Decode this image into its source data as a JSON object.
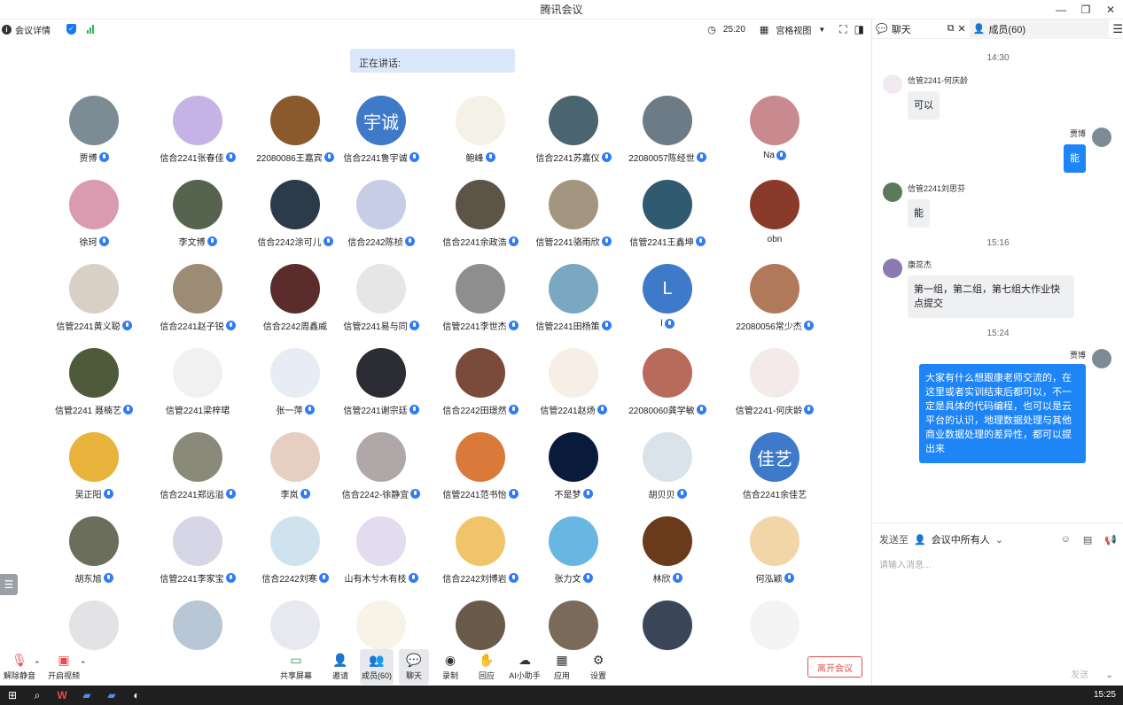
{
  "app": {
    "title": "腾讯会议"
  },
  "infobar": {
    "meeting_info": "会议详情",
    "timer": "25:20",
    "view": "宫格视图"
  },
  "speaking": {
    "label": "正在讲话:"
  },
  "participants": [
    {
      "name": "贾博",
      "color": "#7b8c95"
    },
    {
      "name": "信合2241张春佳",
      "color": "#c5b3e6"
    },
    {
      "name": "22080086王嘉宾",
      "color": "#8a5a2c"
    },
    {
      "name": "信合2241鲁宇诚",
      "color": "#3f79c9",
      "initials": "宇诚"
    },
    {
      "name": "鲍峰",
      "color": "#f4f1e6"
    },
    {
      "name": "信合2241苏嘉仪",
      "color": "#4a6470"
    },
    {
      "name": "22080057陈经世",
      "color": "#6c7b86"
    },
    {
      "name": "Na",
      "color": "#c88a8f"
    },
    {
      "name": "徐珂",
      "color": "#d99bb0"
    },
    {
      "name": "李文博",
      "color": "#56634e"
    },
    {
      "name": "信合2242涂可儿",
      "color": "#2b3b4a"
    },
    {
      "name": "信合2242陈桢",
      "color": "#c7cde6"
    },
    {
      "name": "信合2241余政浩",
      "color": "#5e5347"
    },
    {
      "name": "信管2241骆雨欣",
      "color": "#a39680"
    },
    {
      "name": "信管2241王鑫坤",
      "color": "#2f5a70"
    },
    {
      "name": "obn",
      "color": "#8a3a2a"
    },
    {
      "name": "信管2241黄义聪",
      "color": "#d9cfc5"
    },
    {
      "name": "信合2241赵子锐",
      "color": "#9c8c76"
    },
    {
      "name": "信合2242周鑫威",
      "color": "#5a2c2c"
    },
    {
      "name": "信管2241易与同",
      "color": "#e6e6e6"
    },
    {
      "name": "信管2241李世杰",
      "color": "#8e8e8e"
    },
    {
      "name": "信管2241田杨策",
      "color": "#7aa8c2"
    },
    {
      "name": "l",
      "color": "#3f79c9",
      "initials": "L"
    },
    {
      "name": "22080056常少杰",
      "color": "#b07a5a"
    },
    {
      "name": "信管2241 聂楠艺",
      "color": "#4e5a3a"
    },
    {
      "name": "信管2241梁梓珺",
      "color": "#f1f1f1"
    },
    {
      "name": "张一萍",
      "color": "#e8edf5"
    },
    {
      "name": "信管2241谢宗廷",
      "color": "#2c2c34"
    },
    {
      "name": "信合2242田璟然",
      "color": "#7a4a3a"
    },
    {
      "name": "信管2241赵炀",
      "color": "#f7efe6"
    },
    {
      "name": "22080060龚学敏",
      "color": "#b86b5a"
    },
    {
      "name": "信管2241-何庆龄",
      "color": "#f5eaea"
    },
    {
      "name": "吴正阳",
      "color": "#e8b33a"
    },
    {
      "name": "信合2241郑远溢",
      "color": "#8a8a7a"
    },
    {
      "name": "李岚",
      "color": "#e6cfc0"
    },
    {
      "name": "信合2242-徐静宜",
      "color": "#b0a8a8"
    },
    {
      "name": "信管2241范书怡",
      "color": "#d97a3a"
    },
    {
      "name": "不是梦",
      "color": "#0a1a3a"
    },
    {
      "name": "胡贝贝",
      "color": "#dbe3ea"
    },
    {
      "name": "信合2241余佳艺",
      "color": "#3f79c9",
      "initials": "佳艺"
    },
    {
      "name": "胡东旭",
      "color": "#6a6e5a"
    },
    {
      "name": "信管2241李家宝",
      "color": "#d6d6e6"
    },
    {
      "name": "信合2242刘寒",
      "color": "#cfe3ee"
    },
    {
      "name": "山有木兮木有枝",
      "color": "#e3dbee"
    },
    {
      "name": "信合2242刘博岩",
      "color": "#f2c46a"
    },
    {
      "name": "张力文",
      "color": "#6ab6e3"
    },
    {
      "name": "林欣",
      "color": "#6a3a1a"
    },
    {
      "name": "何泓颖",
      "color": "#f1d6a8"
    },
    {
      "name": "",
      "color": "#e3e3e6"
    },
    {
      "name": "",
      "color": "#b8c6d6"
    },
    {
      "name": "",
      "color": "#e8e8f0"
    },
    {
      "name": "",
      "color": "#f7f3e6"
    },
    {
      "name": "",
      "color": "#6a5a4a"
    },
    {
      "name": "",
      "color": "#7a6a5a"
    },
    {
      "name": "",
      "color": "#3a4658"
    },
    {
      "name": "",
      "color": "#f4f4f4"
    }
  ],
  "toolbar": {
    "unmute": "解除静音",
    "start_video": "开启视频",
    "share": "共享屏幕",
    "invite": "邀请",
    "members": "成员(60)",
    "chat": "聊天",
    "record": "录制",
    "react": "回应",
    "ai": "AI小助手",
    "apps": "应用",
    "settings": "设置",
    "leave": "离开会议"
  },
  "chat": {
    "tab_chat": "聊天",
    "tab_members": "成员(60)",
    "messages": [
      {
        "time": "14:30"
      },
      {
        "sender": "信管2241-何庆龄",
        "text": "可以",
        "dir": "in"
      },
      {
        "sender": "贾博",
        "text": "能",
        "dir": "out"
      },
      {
        "sender": "信管2241刘思芬",
        "text": "能",
        "dir": "in"
      },
      {
        "time": "15:16"
      },
      {
        "sender": "康蕊杰",
        "text": "第一组，第二组，第七组大作业快点提交",
        "dir": "in"
      },
      {
        "time": "15:24"
      },
      {
        "sender": "贾博",
        "text": "大家有什么想跟康老师交流的，在这里或者实训结束后都可以，不一定是具体的代码编程，也可以是云平台的认识，地理数据处理与其他商业数据处理的差异性，都可以提出来",
        "dir": "out"
      }
    ],
    "send_to_label": "发送至",
    "send_to_target": "会议中所有人",
    "input_placeholder": "请输入消息...",
    "send": "发送"
  },
  "taskbar": {
    "clock": "15:25"
  }
}
